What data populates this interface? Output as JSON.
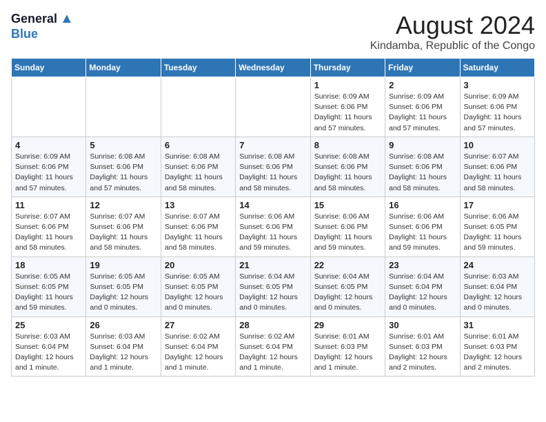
{
  "header": {
    "logo_general": "General",
    "logo_blue": "Blue",
    "title": "August 2024",
    "subtitle": "Kindamba, Republic of the Congo"
  },
  "weekdays": [
    "Sunday",
    "Monday",
    "Tuesday",
    "Wednesday",
    "Thursday",
    "Friday",
    "Saturday"
  ],
  "weeks": [
    [
      {
        "day": "",
        "info": ""
      },
      {
        "day": "",
        "info": ""
      },
      {
        "day": "",
        "info": ""
      },
      {
        "day": "",
        "info": ""
      },
      {
        "day": "1",
        "info": "Sunrise: 6:09 AM\nSunset: 6:06 PM\nDaylight: 11 hours\nand 57 minutes."
      },
      {
        "day": "2",
        "info": "Sunrise: 6:09 AM\nSunset: 6:06 PM\nDaylight: 11 hours\nand 57 minutes."
      },
      {
        "day": "3",
        "info": "Sunrise: 6:09 AM\nSunset: 6:06 PM\nDaylight: 11 hours\nand 57 minutes."
      }
    ],
    [
      {
        "day": "4",
        "info": "Sunrise: 6:09 AM\nSunset: 6:06 PM\nDaylight: 11 hours\nand 57 minutes."
      },
      {
        "day": "5",
        "info": "Sunrise: 6:08 AM\nSunset: 6:06 PM\nDaylight: 11 hours\nand 57 minutes."
      },
      {
        "day": "6",
        "info": "Sunrise: 6:08 AM\nSunset: 6:06 PM\nDaylight: 11 hours\nand 58 minutes."
      },
      {
        "day": "7",
        "info": "Sunrise: 6:08 AM\nSunset: 6:06 PM\nDaylight: 11 hours\nand 58 minutes."
      },
      {
        "day": "8",
        "info": "Sunrise: 6:08 AM\nSunset: 6:06 PM\nDaylight: 11 hours\nand 58 minutes."
      },
      {
        "day": "9",
        "info": "Sunrise: 6:08 AM\nSunset: 6:06 PM\nDaylight: 11 hours\nand 58 minutes."
      },
      {
        "day": "10",
        "info": "Sunrise: 6:07 AM\nSunset: 6:06 PM\nDaylight: 11 hours\nand 58 minutes."
      }
    ],
    [
      {
        "day": "11",
        "info": "Sunrise: 6:07 AM\nSunset: 6:06 PM\nDaylight: 11 hours\nand 58 minutes."
      },
      {
        "day": "12",
        "info": "Sunrise: 6:07 AM\nSunset: 6:06 PM\nDaylight: 11 hours\nand 58 minutes."
      },
      {
        "day": "13",
        "info": "Sunrise: 6:07 AM\nSunset: 6:06 PM\nDaylight: 11 hours\nand 58 minutes."
      },
      {
        "day": "14",
        "info": "Sunrise: 6:06 AM\nSunset: 6:06 PM\nDaylight: 11 hours\nand 59 minutes."
      },
      {
        "day": "15",
        "info": "Sunrise: 6:06 AM\nSunset: 6:06 PM\nDaylight: 11 hours\nand 59 minutes."
      },
      {
        "day": "16",
        "info": "Sunrise: 6:06 AM\nSunset: 6:06 PM\nDaylight: 11 hours\nand 59 minutes."
      },
      {
        "day": "17",
        "info": "Sunrise: 6:06 AM\nSunset: 6:05 PM\nDaylight: 11 hours\nand 59 minutes."
      }
    ],
    [
      {
        "day": "18",
        "info": "Sunrise: 6:05 AM\nSunset: 6:05 PM\nDaylight: 11 hours\nand 59 minutes."
      },
      {
        "day": "19",
        "info": "Sunrise: 6:05 AM\nSunset: 6:05 PM\nDaylight: 12 hours\nand 0 minutes."
      },
      {
        "day": "20",
        "info": "Sunrise: 6:05 AM\nSunset: 6:05 PM\nDaylight: 12 hours\nand 0 minutes."
      },
      {
        "day": "21",
        "info": "Sunrise: 6:04 AM\nSunset: 6:05 PM\nDaylight: 12 hours\nand 0 minutes."
      },
      {
        "day": "22",
        "info": "Sunrise: 6:04 AM\nSunset: 6:05 PM\nDaylight: 12 hours\nand 0 minutes."
      },
      {
        "day": "23",
        "info": "Sunrise: 6:04 AM\nSunset: 6:04 PM\nDaylight: 12 hours\nand 0 minutes."
      },
      {
        "day": "24",
        "info": "Sunrise: 6:03 AM\nSunset: 6:04 PM\nDaylight: 12 hours\nand 0 minutes."
      }
    ],
    [
      {
        "day": "25",
        "info": "Sunrise: 6:03 AM\nSunset: 6:04 PM\nDaylight: 12 hours\nand 1 minute."
      },
      {
        "day": "26",
        "info": "Sunrise: 6:03 AM\nSunset: 6:04 PM\nDaylight: 12 hours\nand 1 minute."
      },
      {
        "day": "27",
        "info": "Sunrise: 6:02 AM\nSunset: 6:04 PM\nDaylight: 12 hours\nand 1 minute."
      },
      {
        "day": "28",
        "info": "Sunrise: 6:02 AM\nSunset: 6:04 PM\nDaylight: 12 hours\nand 1 minute."
      },
      {
        "day": "29",
        "info": "Sunrise: 6:01 AM\nSunset: 6:03 PM\nDaylight: 12 hours\nand 1 minute."
      },
      {
        "day": "30",
        "info": "Sunrise: 6:01 AM\nSunset: 6:03 PM\nDaylight: 12 hours\nand 2 minutes."
      },
      {
        "day": "31",
        "info": "Sunrise: 6:01 AM\nSunset: 6:03 PM\nDaylight: 12 hours\nand 2 minutes."
      }
    ]
  ]
}
